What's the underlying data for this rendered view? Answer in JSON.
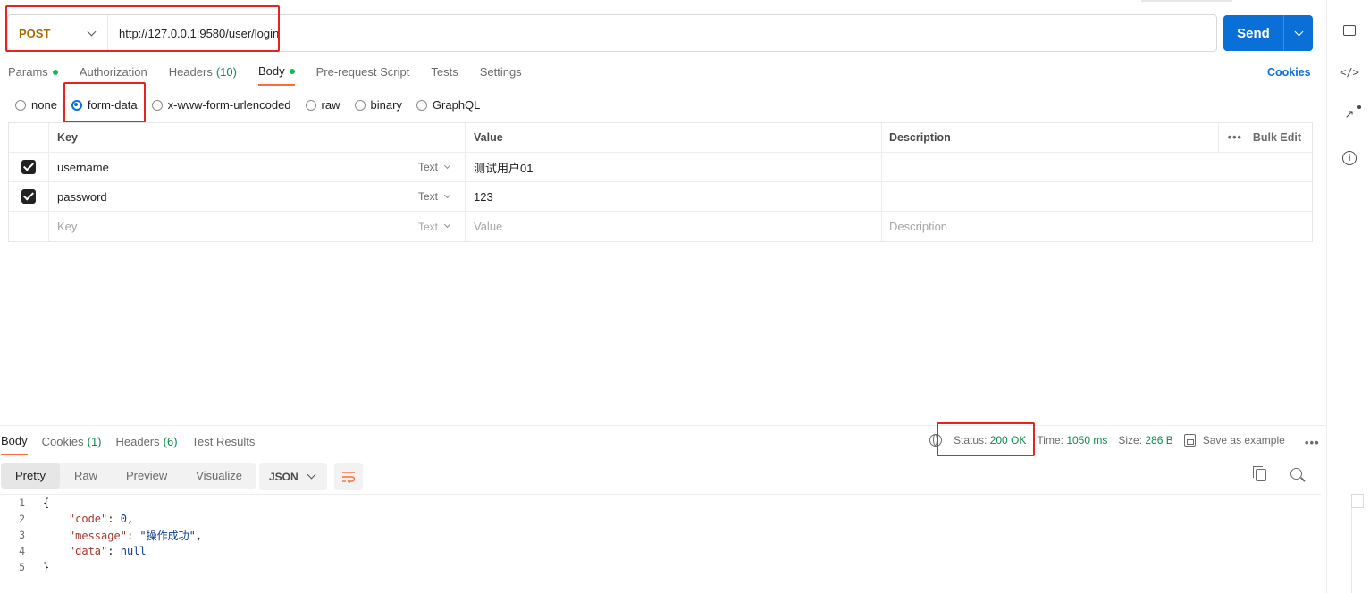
{
  "request": {
    "method": "POST",
    "url": "http://127.0.0.1:9580/user/login",
    "send_label": "Send"
  },
  "request_tabs": {
    "params": "Params",
    "authorization": "Authorization",
    "headers": "Headers",
    "headers_count": "(10)",
    "body": "Body",
    "pre_request": "Pre-request Script",
    "tests": "Tests",
    "settings": "Settings",
    "cookies": "Cookies"
  },
  "body_types": {
    "none": "none",
    "form_data": "form-data",
    "urlencoded": "x-www-form-urlencoded",
    "raw": "raw",
    "binary": "binary",
    "graphql": "GraphQL",
    "selected": "form-data"
  },
  "form_table": {
    "headers": {
      "key": "Key",
      "value": "Value",
      "description": "Description",
      "bulk_edit": "Bulk Edit",
      "more": "•••"
    },
    "rows": [
      {
        "key": "username",
        "type": "Text",
        "value": "测试用户01",
        "description": ""
      },
      {
        "key": "password",
        "type": "Text",
        "value": "123",
        "description": ""
      }
    ],
    "placeholder": {
      "key": "Key",
      "type": "Text",
      "value": "Value",
      "description": "Description"
    }
  },
  "response": {
    "tabs": {
      "body": "Body",
      "cookies": "Cookies",
      "cookies_count": "(1)",
      "headers": "Headers",
      "headers_count": "(6)",
      "test_results": "Test Results"
    },
    "status_label": "Status:",
    "status_value": "200 OK",
    "time_label": "Time:",
    "time_value": "1050 ms",
    "size_label": "Size:",
    "size_value": "286 B",
    "save_example": "Save as example",
    "more": "•••",
    "view_modes": {
      "pretty": "Pretty",
      "raw": "Raw",
      "preview": "Preview",
      "visualize": "Visualize"
    },
    "format": "JSON",
    "code_lines": {
      "l1": {
        "num": "1",
        "text": "{"
      },
      "l2": {
        "num": "2",
        "key": "\"code\"",
        "sep": ": ",
        "val": "0",
        "tail": ","
      },
      "l3": {
        "num": "3",
        "key": "\"message\"",
        "sep": ": ",
        "val": "\"操作成功\"",
        "tail": ","
      },
      "l4": {
        "num": "4",
        "key": "\"data\"",
        "sep": ": ",
        "val": "null",
        "tail": ""
      },
      "l5": {
        "num": "5",
        "text": "}"
      }
    }
  },
  "sidebar_icons": [
    "comments-icon",
    "code-icon",
    "related-collections-icon",
    "info-icon"
  ],
  "colors": {
    "accent": "#0a6fd6",
    "tab_active_underline": "#ff6c37",
    "highlight_box": "#e8231f",
    "status_ok": "#0b8a4b",
    "method_post": "#a86b00"
  }
}
